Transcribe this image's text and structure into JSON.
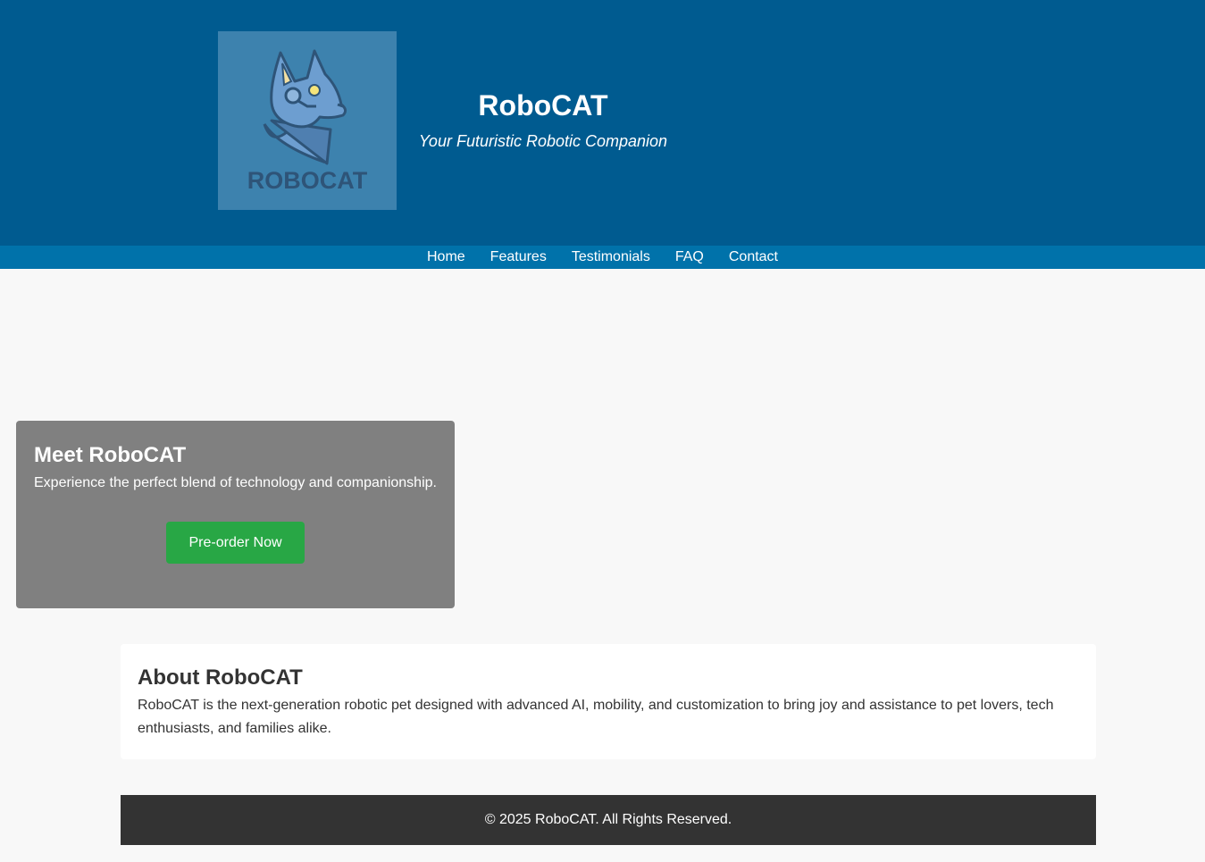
{
  "header": {
    "title": "RoboCAT",
    "tagline": "Your Futuristic Robotic Companion",
    "logo_text": "ROBOCAT",
    "background": "#005b90"
  },
  "nav": {
    "items": [
      {
        "label": "Home"
      },
      {
        "label": "Features"
      },
      {
        "label": "Testimonials"
      },
      {
        "label": "FAQ"
      },
      {
        "label": "Contact"
      }
    ],
    "background": "#0072aa"
  },
  "hero": {
    "heading": "Meet RoboCAT",
    "text": "Experience the perfect blend of technology and companionship.",
    "button_label": "Pre-order Now",
    "button_color": "#28a745"
  },
  "about": {
    "heading": "About RoboCAT",
    "text": "RoboCAT is the next-generation robotic pet designed with advanced AI, mobility, and customization to bring joy and assistance to pet lovers, tech enthusiasts, and families alike."
  },
  "footer": {
    "text": "© 2025 RoboCAT. All Rights Reserved."
  }
}
